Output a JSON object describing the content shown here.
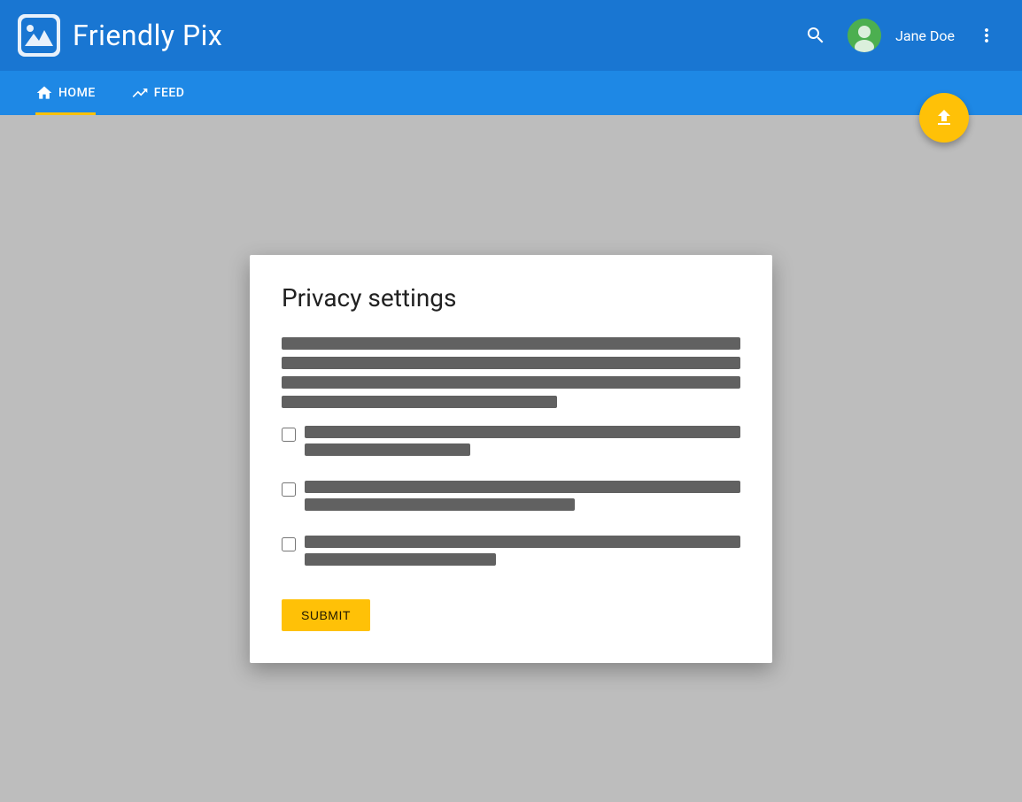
{
  "header": {
    "app_title": "Friendly Pix",
    "user_name": "Jane Doe",
    "avatar_bg": "#4CAF50"
  },
  "navbar": {
    "home_label": "HOME",
    "feed_label": "FEED",
    "active_tab": "home"
  },
  "fab": {
    "icon": "upload-icon"
  },
  "dialog": {
    "title": "Privacy settings",
    "description_lines": [
      {
        "width": "100%"
      },
      {
        "width": "100%"
      },
      {
        "width": "100%"
      },
      {
        "width": "60%"
      }
    ],
    "checkboxes": [
      {
        "line1_width": "100%",
        "line2_width": "38%",
        "checked": false
      },
      {
        "line1_width": "100%",
        "line2_width": "62%",
        "checked": false
      },
      {
        "line1_width": "100%",
        "line2_width": "44%",
        "checked": false
      }
    ],
    "submit_label": "SUBMIT"
  }
}
